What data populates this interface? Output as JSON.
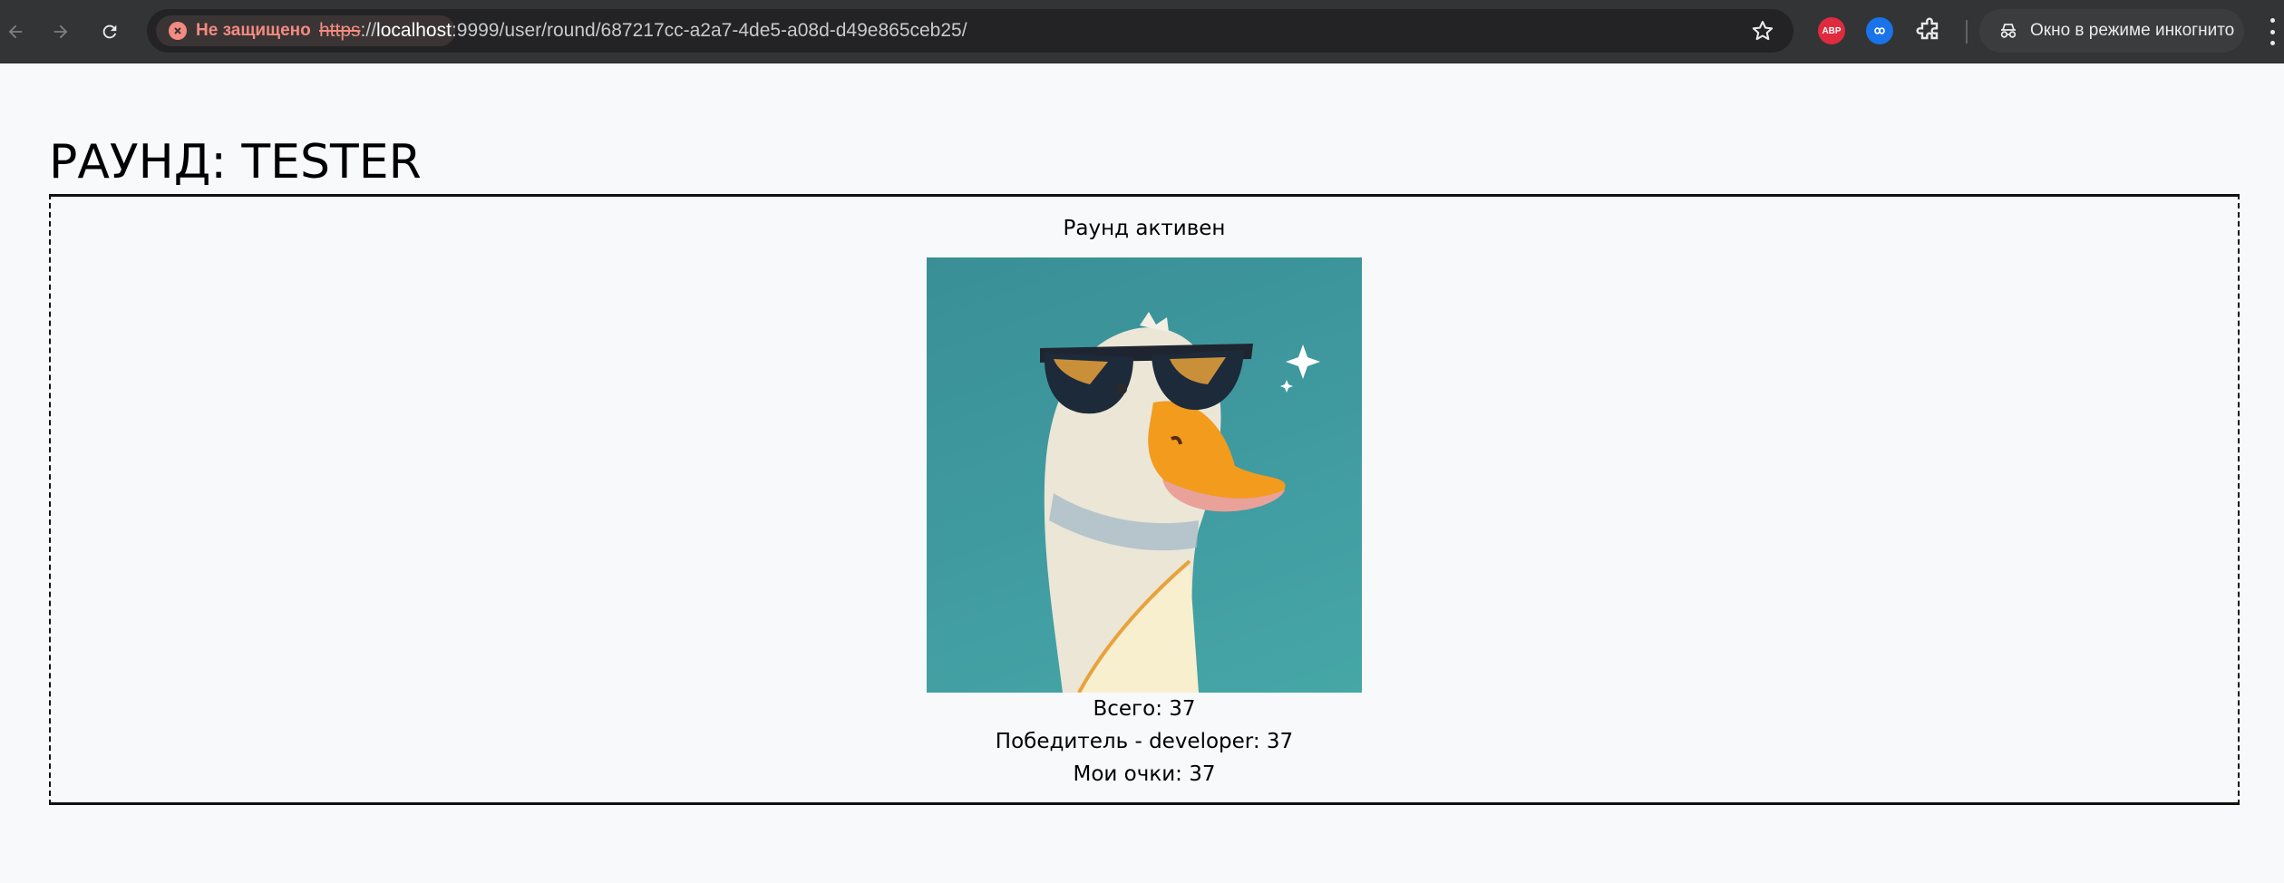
{
  "browser": {
    "security_chip": "Не защищено",
    "url_scheme": "https",
    "url_sep": "://",
    "url_host": "localhost",
    "url_rest": ":9999/user/round/687217cc-a2a7-4de5-a08d-d49e865ceb25/",
    "incognito_label": "Окно в режиме инкогнито",
    "abp_label": "ABP",
    "icons": [
      "back-arrow-icon",
      "forward-arrow-icon",
      "reload-icon",
      "not-secure-icon",
      "bookmark-star-icon",
      "adblock-plus-icon",
      "infinity-extension-icon",
      "extensions-puzzle-icon",
      "incognito-icon",
      "menu-kebab-icon"
    ],
    "accent_warning": "#f28b82"
  },
  "page": {
    "title": "РАУНД: TESTER",
    "round_status": "Раунд активен",
    "total": "Всего: 37",
    "winner": "Победитель - developer: 37",
    "my_points": "Мои очки: 37"
  }
}
